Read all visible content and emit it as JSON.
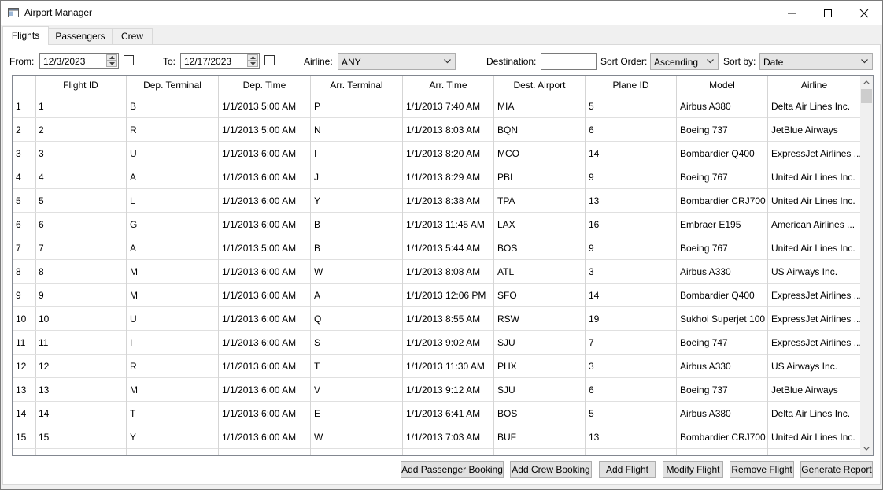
{
  "window": {
    "title": "Airport Manager"
  },
  "tabs": [
    {
      "label": "Flights"
    },
    {
      "label": "Passengers"
    },
    {
      "label": "Crew"
    }
  ],
  "filters": {
    "from_label": "From:",
    "from_value": "12/3/2023",
    "to_label": "To:",
    "to_value": "12/17/2023",
    "airline_label": "Airline:",
    "airline_value": "ANY",
    "destination_label": "Destination:",
    "destination_value": "",
    "sort_order_label": "Sort Order:",
    "sort_order_value": "Ascending",
    "sort_by_label": "Sort by:",
    "sort_by_value": "Date"
  },
  "grid": {
    "columns": [
      "Flight ID",
      "Dep. Terminal",
      "Dep. Time",
      "Arr. Terminal",
      "Arr. Time",
      "Dest. Airport",
      "Plane ID",
      "Model",
      "Airline"
    ],
    "rows": [
      [
        "1",
        "1",
        "B",
        "1/1/2013 5:00 AM",
        "P",
        "1/1/2013 7:40 AM",
        "MIA",
        "5",
        "Airbus A380",
        "Delta Air Lines Inc."
      ],
      [
        "2",
        "2",
        "R",
        "1/1/2013 5:00 AM",
        "N",
        "1/1/2013 8:03 AM",
        "BQN",
        "6",
        "Boeing 737",
        "JetBlue Airways"
      ],
      [
        "3",
        "3",
        "U",
        "1/1/2013 6:00 AM",
        "I",
        "1/1/2013 8:20 AM",
        "MCO",
        "14",
        "Bombardier Q400",
        "ExpressJet Airlines ..."
      ],
      [
        "4",
        "4",
        "A",
        "1/1/2013 6:00 AM",
        "J",
        "1/1/2013 8:29 AM",
        "PBI",
        "9",
        "Boeing 767",
        "United Air Lines Inc."
      ],
      [
        "5",
        "5",
        "L",
        "1/1/2013 6:00 AM",
        "Y",
        "1/1/2013 8:38 AM",
        "TPA",
        "13",
        "Bombardier CRJ700",
        "United Air Lines Inc."
      ],
      [
        "6",
        "6",
        "G",
        "1/1/2013 6:00 AM",
        "B",
        "1/1/2013 11:45 AM",
        "LAX",
        "16",
        "Embraer E195",
        "American Airlines ..."
      ],
      [
        "7",
        "7",
        "A",
        "1/1/2013 5:00 AM",
        "B",
        "1/1/2013 5:44 AM",
        "BOS",
        "9",
        "Boeing 767",
        "United Air Lines Inc."
      ],
      [
        "8",
        "8",
        "M",
        "1/1/2013 6:00 AM",
        "W",
        "1/1/2013 8:08 AM",
        "ATL",
        "3",
        "Airbus A330",
        "US Airways Inc."
      ],
      [
        "9",
        "9",
        "M",
        "1/1/2013 6:00 AM",
        "A",
        "1/1/2013 12:06 PM",
        "SFO",
        "14",
        "Bombardier Q400",
        "ExpressJet Airlines ..."
      ],
      [
        "10",
        "10",
        "U",
        "1/1/2013 6:00 AM",
        "Q",
        "1/1/2013 8:55 AM",
        "RSW",
        "19",
        "Sukhoi Superjet 100",
        "ExpressJet Airlines ..."
      ],
      [
        "11",
        "11",
        "I",
        "1/1/2013 6:00 AM",
        "S",
        "1/1/2013 9:02 AM",
        "SJU",
        "7",
        "Boeing 747",
        "ExpressJet Airlines ..."
      ],
      [
        "12",
        "12",
        "R",
        "1/1/2013 6:00 AM",
        "T",
        "1/1/2013 11:30 AM",
        "PHX",
        "3",
        "Airbus A330",
        "US Airways Inc."
      ],
      [
        "13",
        "13",
        "M",
        "1/1/2013 6:00 AM",
        "V",
        "1/1/2013 9:12 AM",
        "SJU",
        "6",
        "Boeing 737",
        "JetBlue Airways"
      ],
      [
        "14",
        "14",
        "T",
        "1/1/2013 6:00 AM",
        "E",
        "1/1/2013 6:41 AM",
        "BOS",
        "5",
        "Airbus A380",
        "Delta Air Lines Inc."
      ],
      [
        "15",
        "15",
        "Y",
        "1/1/2013 6:00 AM",
        "W",
        "1/1/2013 7:03 AM",
        "BUF",
        "13",
        "Bombardier CRJ700",
        "United Air Lines Inc."
      ]
    ]
  },
  "actions": {
    "add_passenger_booking": "Add Passenger Booking",
    "add_crew_booking": "Add Crew Booking",
    "add_flight": "Add Flight",
    "modify_flight": "Modify Flight",
    "remove_flight": "Remove Flight",
    "generate_report": "Generate Report"
  },
  "icons": {
    "app": "window-app-icon",
    "minimize": "minimize-icon",
    "maximize": "maximize-icon",
    "close": "close-icon"
  }
}
